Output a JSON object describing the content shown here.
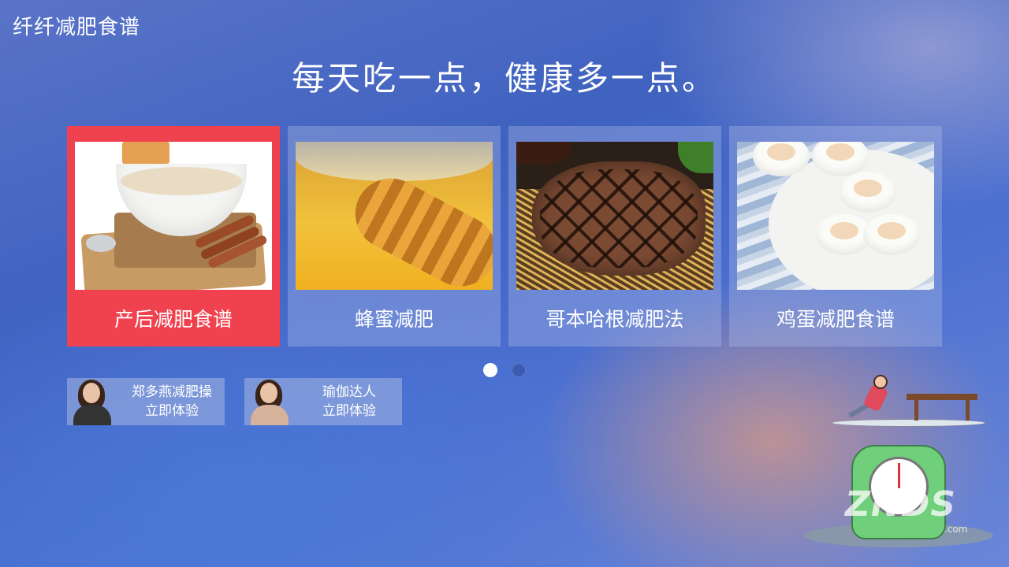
{
  "app": {
    "title": "纤纤减肥食谱"
  },
  "header": {
    "slogan": "每天吃一点，健康多一点。"
  },
  "cards": [
    {
      "label": "产后减肥食谱",
      "image": "oatmeal-bowl-photo",
      "focused": true
    },
    {
      "label": "蜂蜜减肥",
      "image": "honey-dipper-photo",
      "focused": false
    },
    {
      "label": "哥本哈根减肥法",
      "image": "grilled-steak-photo",
      "focused": false
    },
    {
      "label": "鸡蛋减肥食谱",
      "image": "deviled-eggs-photo",
      "focused": false
    }
  ],
  "pagination": {
    "current": 1,
    "total": 2
  },
  "promos": [
    {
      "line1": "郑多燕减肥操",
      "line2": "立即体验"
    },
    {
      "line1": "瑜伽达人",
      "line2": "立即体验"
    }
  ],
  "watermark": {
    "text": "ZNDS",
    "domain": ".com"
  },
  "colors": {
    "focus": "#f0414f",
    "background": "#4a6fd0"
  }
}
